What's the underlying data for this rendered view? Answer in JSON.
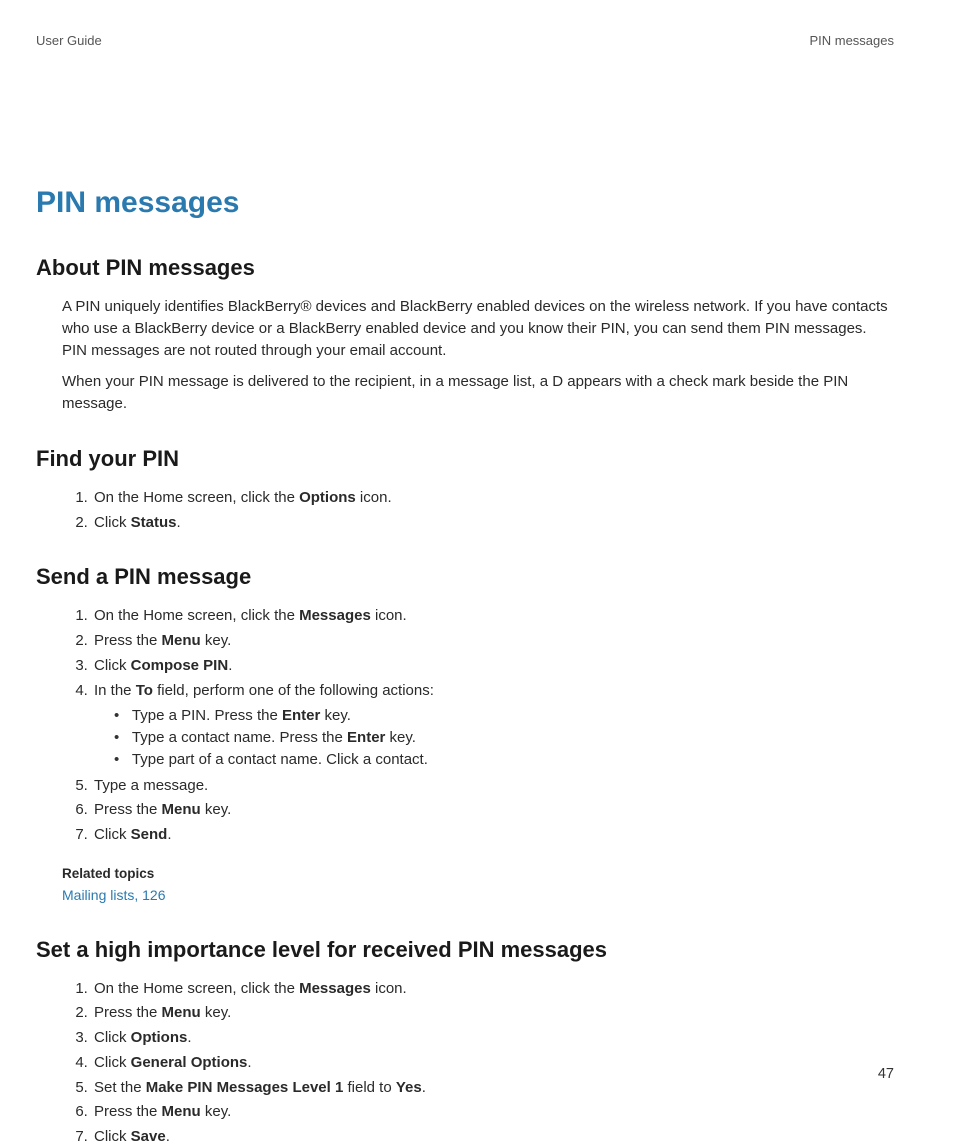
{
  "header": {
    "left": "User Guide",
    "right": "PIN messages"
  },
  "chapter_title": "PIN messages",
  "about": {
    "heading": "About PIN messages",
    "para1": "A PIN uniquely identifies BlackBerry® devices and BlackBerry enabled devices on the wireless network. If you have contacts who use a BlackBerry device or a BlackBerry enabled device and you know their PIN, you can send them PIN messages. PIN messages are not routed through your email account.",
    "para2": "When your PIN message is delivered to the recipient, in a message list, a D appears with a check mark beside the PIN message."
  },
  "find_pin": {
    "heading": "Find your PIN",
    "steps": {
      "s1a": "On the Home screen, click the ",
      "s1b": "Options",
      "s1c": " icon.",
      "s2a": "Click ",
      "s2b": "Status",
      "s2c": "."
    }
  },
  "send_pin": {
    "heading": "Send a PIN message",
    "steps": {
      "s1a": "On the Home screen, click the ",
      "s1b": "Messages",
      "s1c": " icon.",
      "s2a": "Press the ",
      "s2b": "Menu",
      "s2c": " key.",
      "s3a": "Click ",
      "s3b": "Compose PIN",
      "s3c": ".",
      "s4a": "In the ",
      "s4b": "To",
      "s4c": " field, perform one of the following actions:",
      "sub": {
        "a1": "Type a PIN. Press the ",
        "a2": "Enter",
        "a3": " key.",
        "b1": "Type a contact name. Press the ",
        "b2": "Enter",
        "b3": " key.",
        "c1": "Type part of a contact name. Click a contact."
      },
      "s5": "Type a message.",
      "s6a": "Press the ",
      "s6b": "Menu",
      "s6c": " key.",
      "s7a": "Click ",
      "s7b": "Send",
      "s7c": "."
    },
    "related_label": "Related topics",
    "related_link": "Mailing lists, 126"
  },
  "high_importance": {
    "heading": "Set a high importance level for received PIN messages",
    "steps": {
      "s1a": "On the Home screen, click the ",
      "s1b": "Messages",
      "s1c": " icon.",
      "s2a": "Press the ",
      "s2b": "Menu",
      "s2c": " key.",
      "s3a": "Click ",
      "s3b": "Options",
      "s3c": ".",
      "s4a": "Click ",
      "s4b": "General Options",
      "s4c": ".",
      "s5a": "Set the ",
      "s5b": "Make PIN Messages Level 1",
      "s5c": " field to ",
      "s5d": "Yes",
      "s5e": ".",
      "s6a": "Press the ",
      "s6b": "Menu",
      "s6c": " key.",
      "s7a": "Click ",
      "s7b": "Save",
      "s7c": "."
    }
  },
  "page_number": "47"
}
